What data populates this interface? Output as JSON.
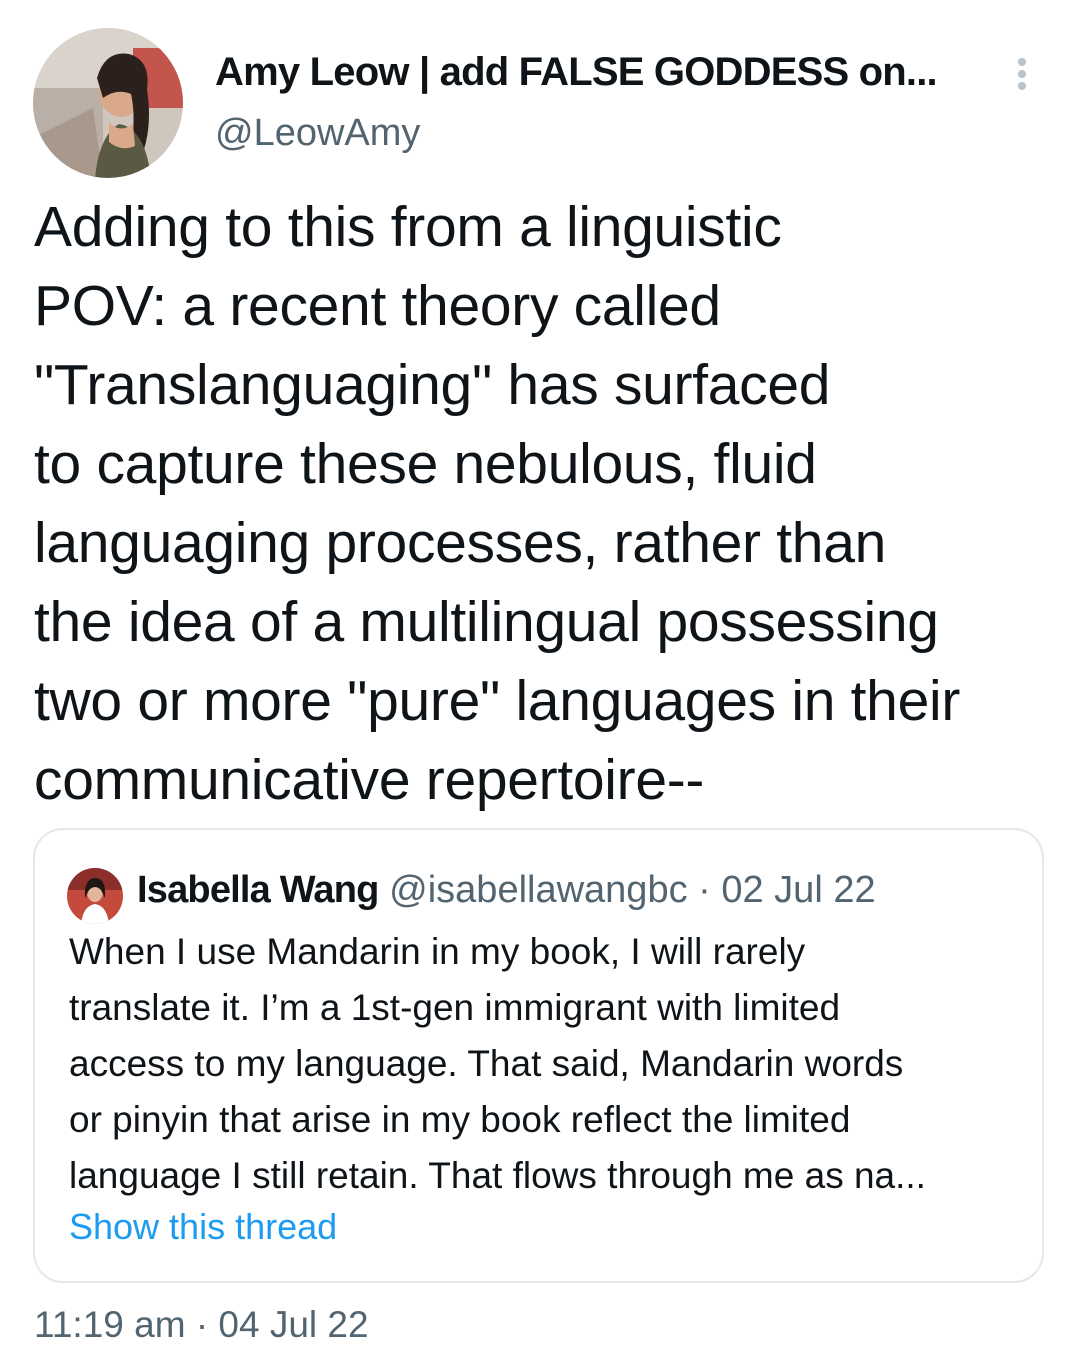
{
  "author": {
    "name": "Amy Leow | add FALSE GODDESS on...",
    "handle": "@LeowAmy"
  },
  "tweet": {
    "text_lines": [
      "Adding to this from a linguistic",
      "POV: a recent theory called",
      "\"Translanguaging\" has surfaced",
      "to capture these nebulous, fluid",
      "languaging processes, rather than",
      "the idea of a multilingual possessing",
      "two or more \"pure\" languages in their",
      "communicative repertoire--"
    ],
    "time": "11:19 am",
    "separator": "·",
    "date": "04 Jul 22"
  },
  "quoted_tweet": {
    "name": "Isabella Wang",
    "handle": "@isabellawangbc",
    "separator": "·",
    "date": "02 Jul 22",
    "text_lines": [
      "When I use Mandarin in my book, I will rarely",
      "translate it. I’m a 1st-gen immigrant with limited",
      "access to my language. That said, Mandarin words",
      "or pinyin that arise in my book reflect the limited",
      "language I still retain. That flows through me as na..."
    ],
    "show_thread_label": "Show this thread"
  },
  "icons": {
    "more": "more-options-icon"
  },
  "colors": {
    "primary_text": "#0f1419",
    "secondary_text": "#536471",
    "link": "#1d9bf0",
    "border": "#e3e8ec"
  }
}
